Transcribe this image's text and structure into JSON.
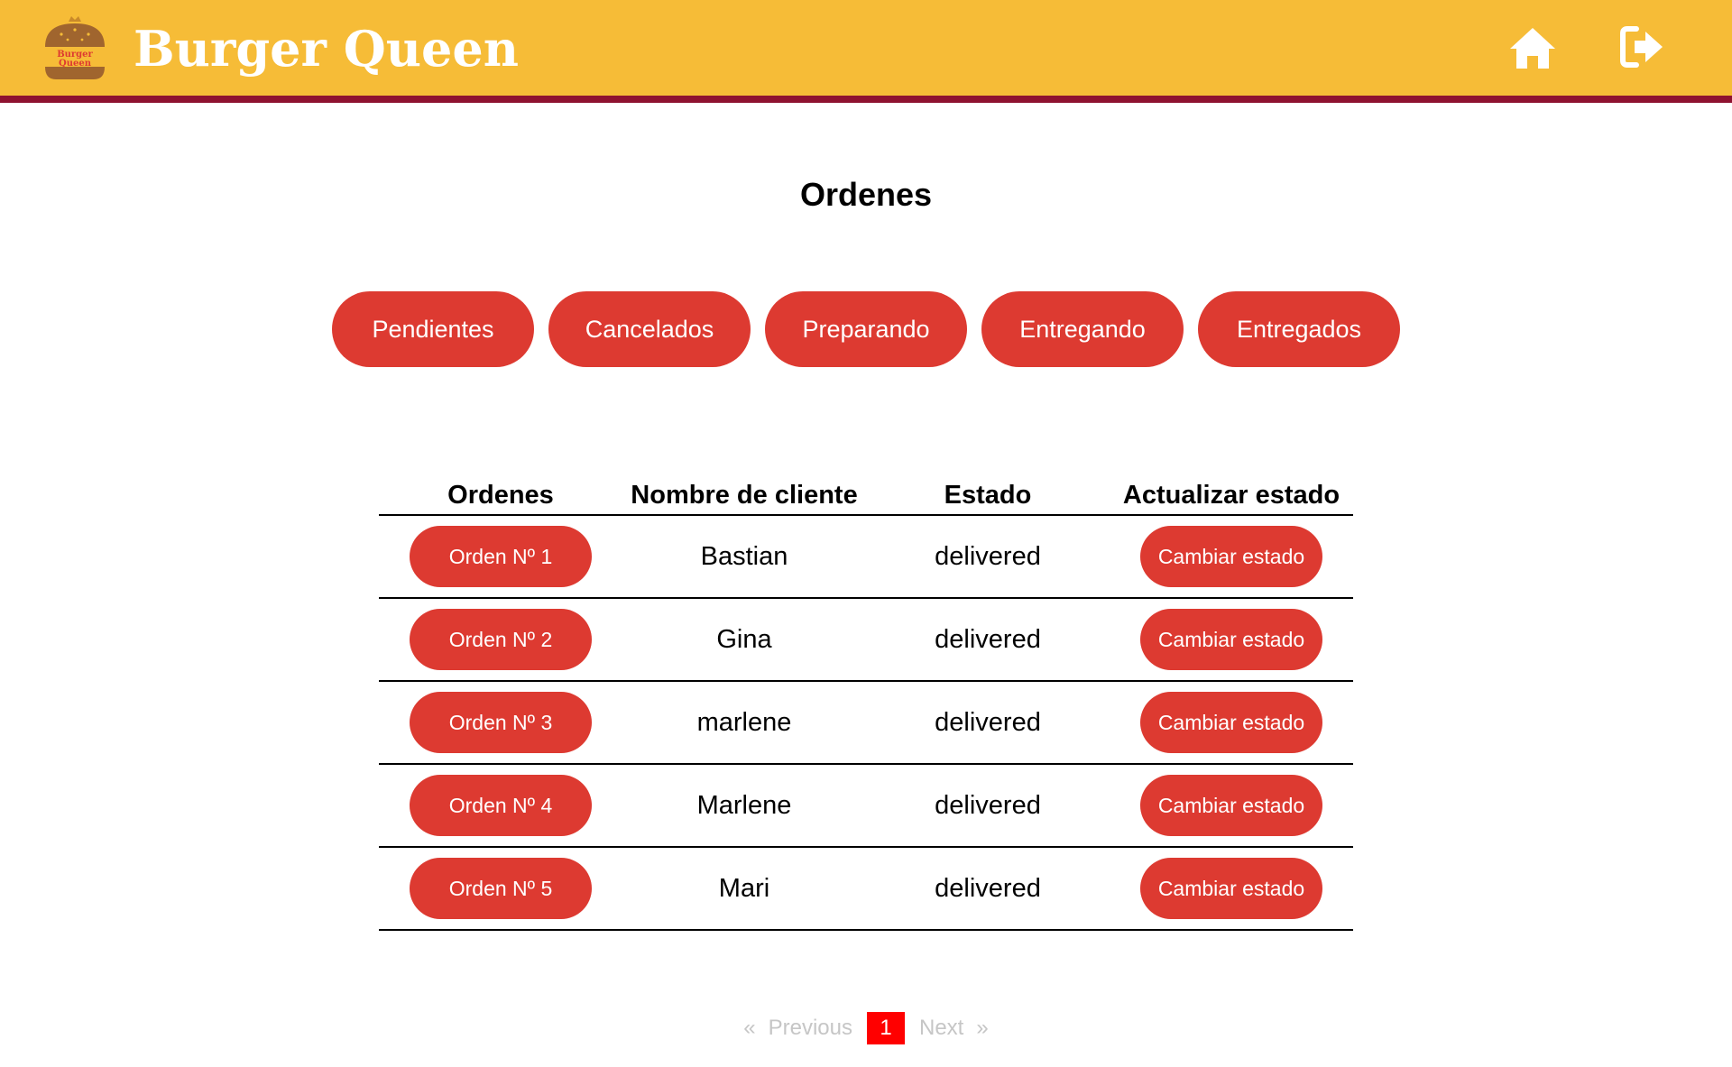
{
  "app": {
    "brand": "Burger Queen",
    "logo_text": "Burger Queen"
  },
  "header": {
    "home_icon": "home-icon",
    "logout_icon": "logout-icon"
  },
  "page": {
    "title": "Ordenes"
  },
  "filters": [
    "Pendientes",
    "Cancelados",
    "Preparando",
    "Entregando",
    "Entregados"
  ],
  "table": {
    "columns": [
      "Ordenes",
      "Nombre de cliente",
      "Estado",
      "Actualizar estado"
    ],
    "rows": [
      {
        "order": "Orden Nº 1",
        "client": "Bastian",
        "status": "delivered",
        "action": "Cambiar estado"
      },
      {
        "order": "Orden Nº 2",
        "client": "Gina",
        "status": "delivered",
        "action": "Cambiar estado"
      },
      {
        "order": "Orden Nº 3",
        "client": "marlene",
        "status": "delivered",
        "action": "Cambiar estado"
      },
      {
        "order": "Orden Nº 4",
        "client": "Marlene",
        "status": "delivered",
        "action": "Cambiar estado"
      },
      {
        "order": "Orden Nº 5",
        "client": "Mari",
        "status": "delivered",
        "action": "Cambiar estado"
      }
    ]
  },
  "pagination": {
    "prev_arrow": "«",
    "previous": "Previous",
    "current": "1",
    "next": "Next",
    "next_arrow": "»"
  },
  "colors": {
    "header_bg": "#F6BC37",
    "header_border": "#8E1230",
    "button": "#DD3A31",
    "current_page": "#FF0000"
  }
}
